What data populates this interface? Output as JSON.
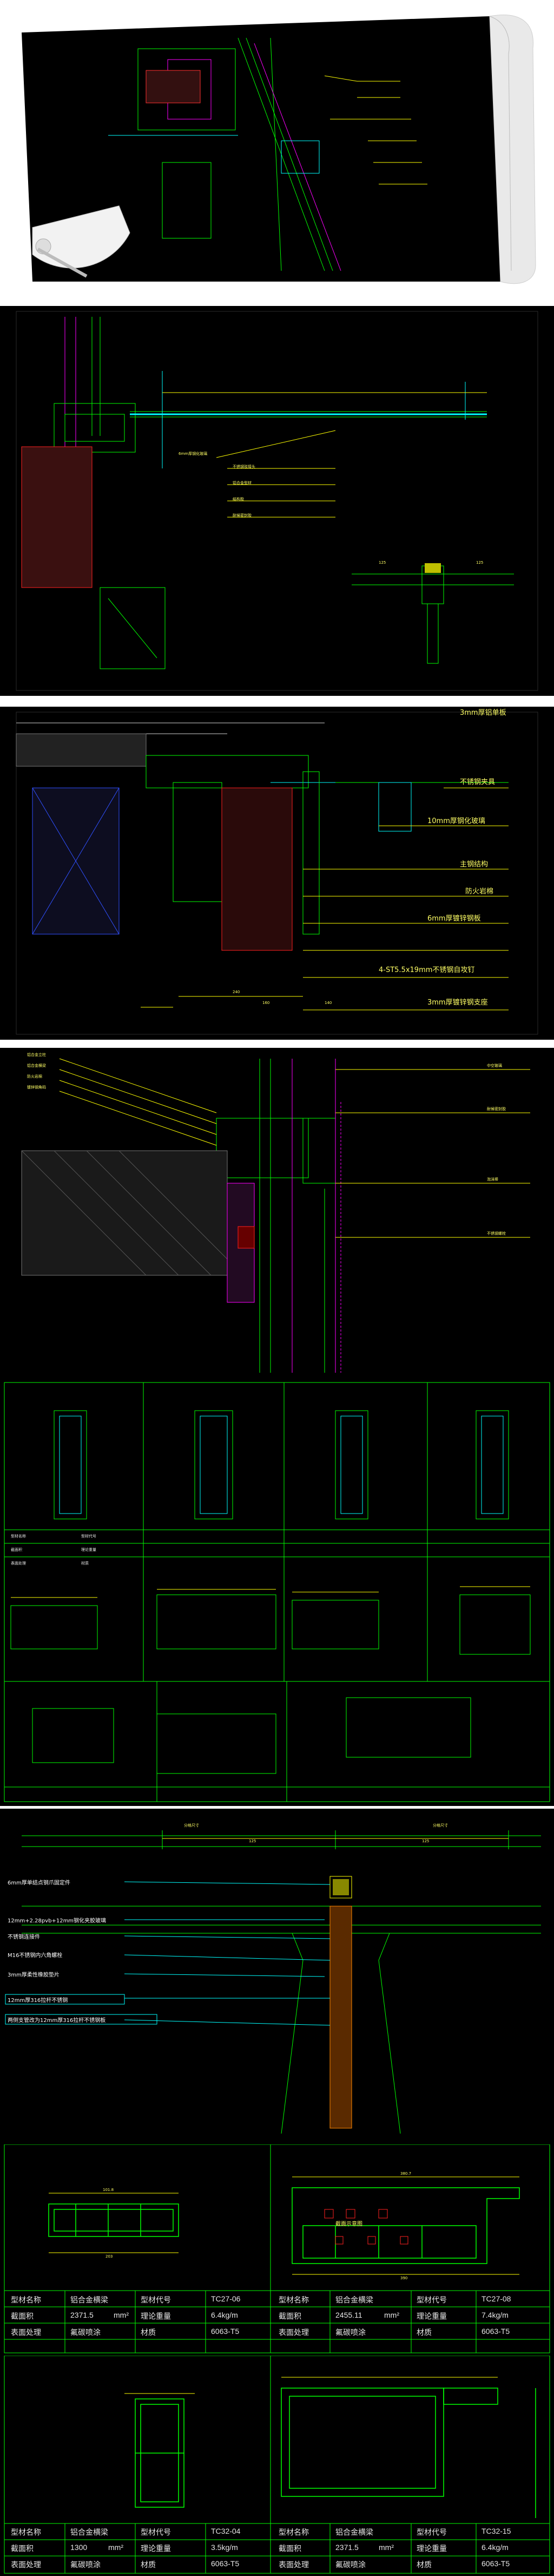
{
  "colors": {
    "background": "#000000",
    "green": "#00ff00",
    "yellow": "#ffff00",
    "cyan": "#00ffff",
    "magenta": "#ff00ff",
    "red": "#ff2020",
    "blue": "#3050ff",
    "white": "#ffffff"
  },
  "panel2": {
    "notes": [
      "6mm厚钢化玻璃",
      "不锈钢驳接头",
      "铝合金型材",
      "结构胶",
      "耐候密封胶"
    ],
    "dims": [
      "125",
      "125"
    ]
  },
  "panel3": {
    "notes": [
      "3mm厚铝单板",
      "不锈钢夹具",
      "10mm厚钢化玻璃",
      "主钢结构",
      "防火岩棉",
      "6mm厚镀锌钢板",
      "4-ST5.5x19mm不锈钢自攻钉",
      "3mm厚镀锌钢支座"
    ],
    "dims": [
      "240",
      "160",
      "140"
    ]
  },
  "panel4": {
    "notes": [
      "铝合金立柱",
      "铝合金横梁",
      "防火岩棉",
      "镀锌钢角码",
      "中空玻璃",
      "耐候密封胶",
      "泡沫棒",
      "不锈钢螺栓"
    ]
  },
  "panel5": {
    "labels": [
      "型材名称",
      "型材代号",
      "截面积",
      "理论重量",
      "表面处理",
      "材质"
    ]
  },
  "panel6": {
    "dims": [
      "分格尺寸",
      "分格尺寸",
      "125",
      "125"
    ],
    "notes": [
      "6mm厚单结点钢爪固定件",
      "12mm+2.28pvb+12mm钢化夹胶玻璃",
      "不锈钢连接件",
      "M16不锈钢内六角螺栓",
      "3mm厚柔性橡胶垫片",
      "12mm厚316拉杆不锈钢",
      "两侧支管改为12mm厚316拉杆不锈钢板"
    ]
  },
  "panel7": {
    "dims_top": [
      "101.8",
      "380.7"
    ],
    "dims_bottom": [
      "203",
      "390"
    ],
    "center_note": "截面示意图",
    "table1": {
      "name_label": "型材名称",
      "name_value": "铝合金横梁",
      "code_label": "型材代号",
      "code_value": "TC27-06",
      "area_label": "截面积",
      "area_value": "2371.5",
      "area_unit": "mm²",
      "weight_label": "理论重量",
      "weight_value": "6.4kg/m",
      "finish_label": "表面处理",
      "finish_value": "氟碳喷涂",
      "material_label": "材质",
      "material_value": "6063-T5"
    },
    "table2": {
      "name_label": "型材名称",
      "name_value": "铝合金横梁",
      "code_label": "型材代号",
      "code_value": "TC27-08",
      "area_label": "截面积",
      "area_value": "2455.11",
      "area_unit": "mm²",
      "weight_label": "理论重量",
      "weight_value": "7.4kg/m",
      "finish_label": "表面处理",
      "finish_value": "氟碳喷涂",
      "material_label": "材质",
      "material_value": "6063-T5"
    }
  },
  "panel8": {
    "table1": {
      "name_label": "型材名称",
      "name_value": "铝合金横梁",
      "code_label": "型材代号",
      "code_value": "TC32-04",
      "area_label": "截面积",
      "area_value": "1300",
      "area_unit": "mm²",
      "weight_label": "理论重量",
      "weight_value": "3.5kg/m",
      "finish_label": "表面处理",
      "finish_value": "氟碳喷涂",
      "material_label": "材质",
      "material_value": "6063-T5"
    },
    "table2": {
      "name_label": "型材名称",
      "name_value": "铝合金横梁",
      "code_label": "型材代号",
      "code_value": "TC32-15",
      "area_label": "截面积",
      "area_value": "2371.5",
      "area_unit": "mm²",
      "weight_label": "理论重量",
      "weight_value": "6.4kg/m",
      "finish_label": "表面处理",
      "finish_value": "氟碳喷涂",
      "material_label": "材质",
      "material_value": "6063-T5"
    }
  }
}
